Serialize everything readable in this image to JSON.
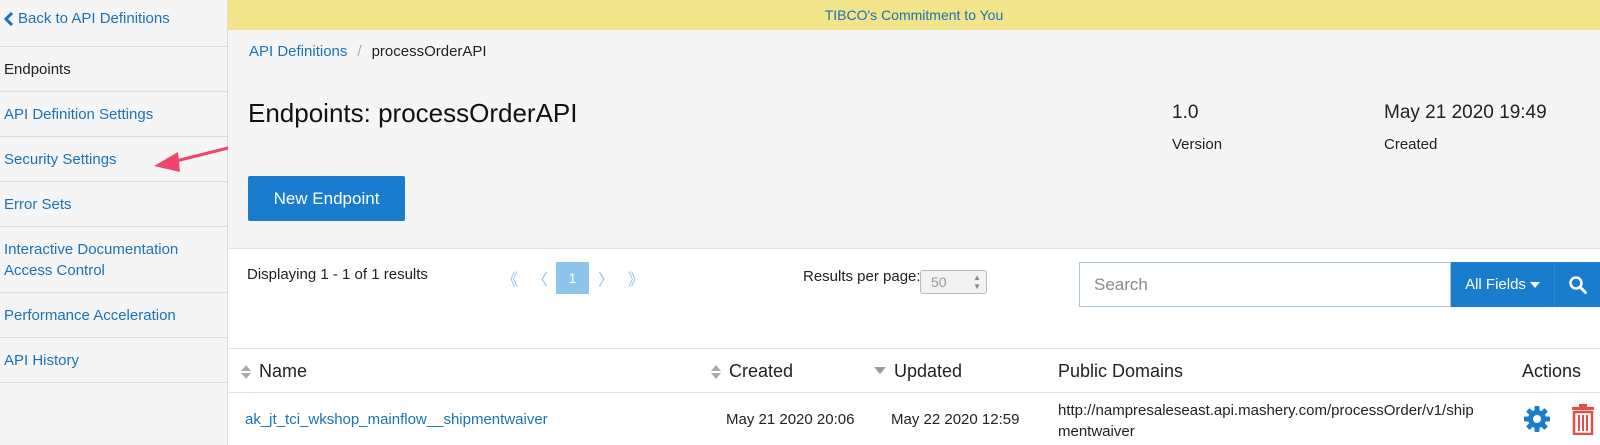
{
  "sidebar": {
    "back_label": "Back to API Definitions",
    "items": [
      {
        "label": "Endpoints"
      },
      {
        "label": "API Definition Settings"
      },
      {
        "label": "Security Settings"
      },
      {
        "label": "Error Sets"
      },
      {
        "label": "Interactive Documentation Access Control"
      },
      {
        "label": "Performance Acceleration"
      },
      {
        "label": "API History"
      }
    ],
    "annotation_color": "#f0456f"
  },
  "banner": {
    "text": "TIBCO's Commitment to You"
  },
  "breadcrumb": {
    "root": "API Definitions",
    "separator": "/",
    "current": "processOrderAPI"
  },
  "header": {
    "title": "Endpoints: processOrderAPI",
    "version_value": "1.0",
    "version_label": "Version",
    "created_value": "May 21 2020 19:49",
    "created_label": "Created",
    "new_button_label": "New Endpoint"
  },
  "toolbar": {
    "result_count": "Displaying 1 - 1 of 1 results",
    "pager": {
      "first": "《",
      "prev": "〈",
      "current": "1",
      "next": "〉",
      "last": "》"
    },
    "rpp_label": "Results per page:",
    "rpp_value": "50",
    "search_placeholder": "Search",
    "search_scope": "All Fields"
  },
  "table": {
    "headers": {
      "name": "Name",
      "created": "Created",
      "updated": "Updated",
      "domains": "Public Domains",
      "actions": "Actions"
    },
    "rows": [
      {
        "name": "ak_jt_tci_wkshop_mainflow__shipmentwaiver",
        "created": "May 21 2020 20:06",
        "updated": "May 22 2020 12:59",
        "domain_line1": "http://nampresaleseast.api.mashery.com/processOrder/v1/ship",
        "domain_line2": "mentwaiver"
      }
    ]
  },
  "colors": {
    "accent": "#1a7ccc",
    "link": "#1a73b8",
    "banner": "#f1e48a",
    "delete": "#e94b4b"
  }
}
